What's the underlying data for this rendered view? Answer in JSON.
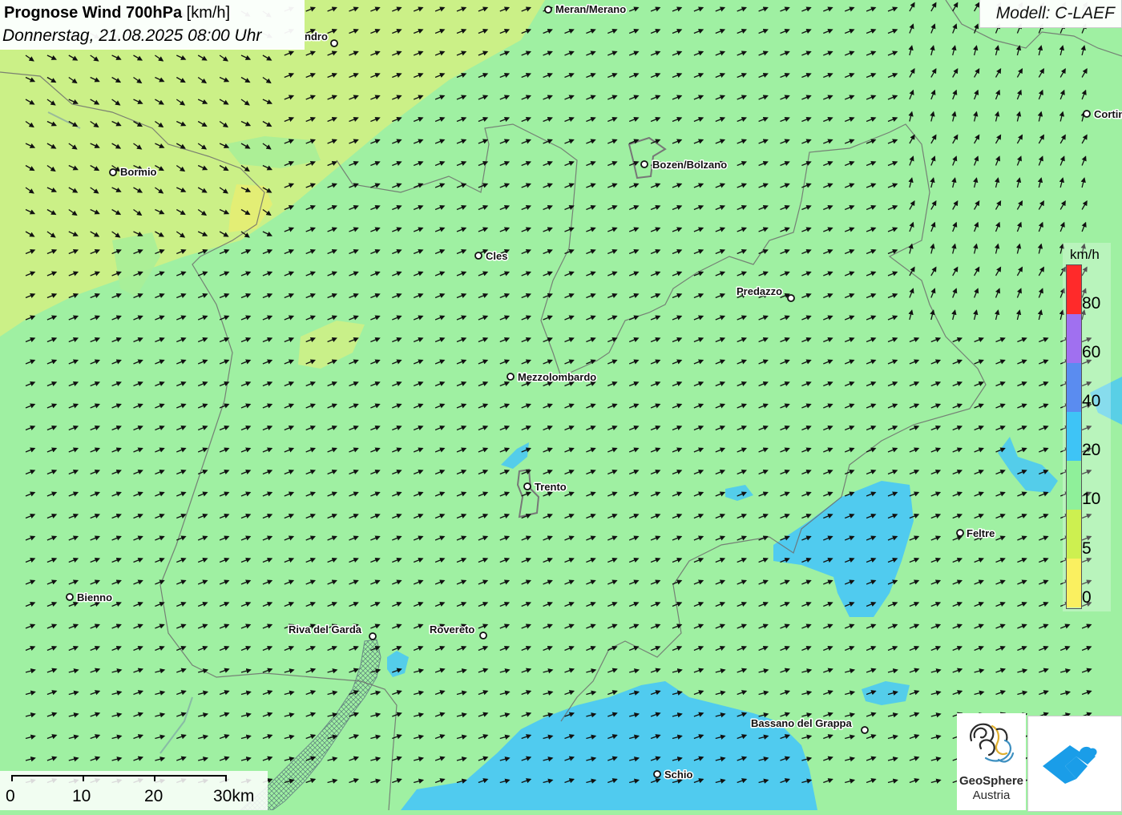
{
  "header": {
    "title_bold": "Prognose Wind 700hPa",
    "title_unit": "[km/h]",
    "datetime": "Donnerstag, 21.08.2025 08:00 Uhr"
  },
  "model": {
    "label": "Modell: C-LAEF"
  },
  "cities": [
    {
      "name": "Meran/Merano"
    },
    {
      "name": "ndro"
    },
    {
      "name": "Bormio"
    },
    {
      "name": "Bozen/Bolzano"
    },
    {
      "name": "Cortina"
    },
    {
      "name": "Cles"
    },
    {
      "name": "Predazzo"
    },
    {
      "name": "Mezzolombardo"
    },
    {
      "name": "Trento"
    },
    {
      "name": "Feltre"
    },
    {
      "name": "Bienno"
    },
    {
      "name": "Riva del Garda"
    },
    {
      "name": "Rovereto"
    },
    {
      "name": "Bassano del Grappa"
    },
    {
      "name": "Schio"
    }
  ],
  "legend": {
    "unit": "km/h",
    "classes": [
      {
        "value": "80",
        "color": "#ff2a2a"
      },
      {
        "value": "60",
        "color": "#a070f0"
      },
      {
        "value": "40",
        "color": "#5a8cf0"
      },
      {
        "value": "20",
        "color": "#3ec4f6"
      },
      {
        "value": "10",
        "color": "#8ff09a"
      },
      {
        "value": "5",
        "color": "#cdf050"
      },
      {
        "value": "0",
        "color": "#faf060"
      }
    ]
  },
  "scalebar": {
    "labels": [
      "0",
      "10",
      "20",
      "30km"
    ]
  },
  "logos": {
    "geosphere_name": "GeoSphere",
    "geosphere_country": "Austria",
    "geosphere_icon": "geosphere-logo-icon",
    "warning_icon": "blue-mountain-logo-icon"
  },
  "colors": {
    "base_green": "#9ff0a2",
    "yellow_green": "#cdf080",
    "light_blue": "#47c7f7",
    "arrow": "#111111"
  }
}
